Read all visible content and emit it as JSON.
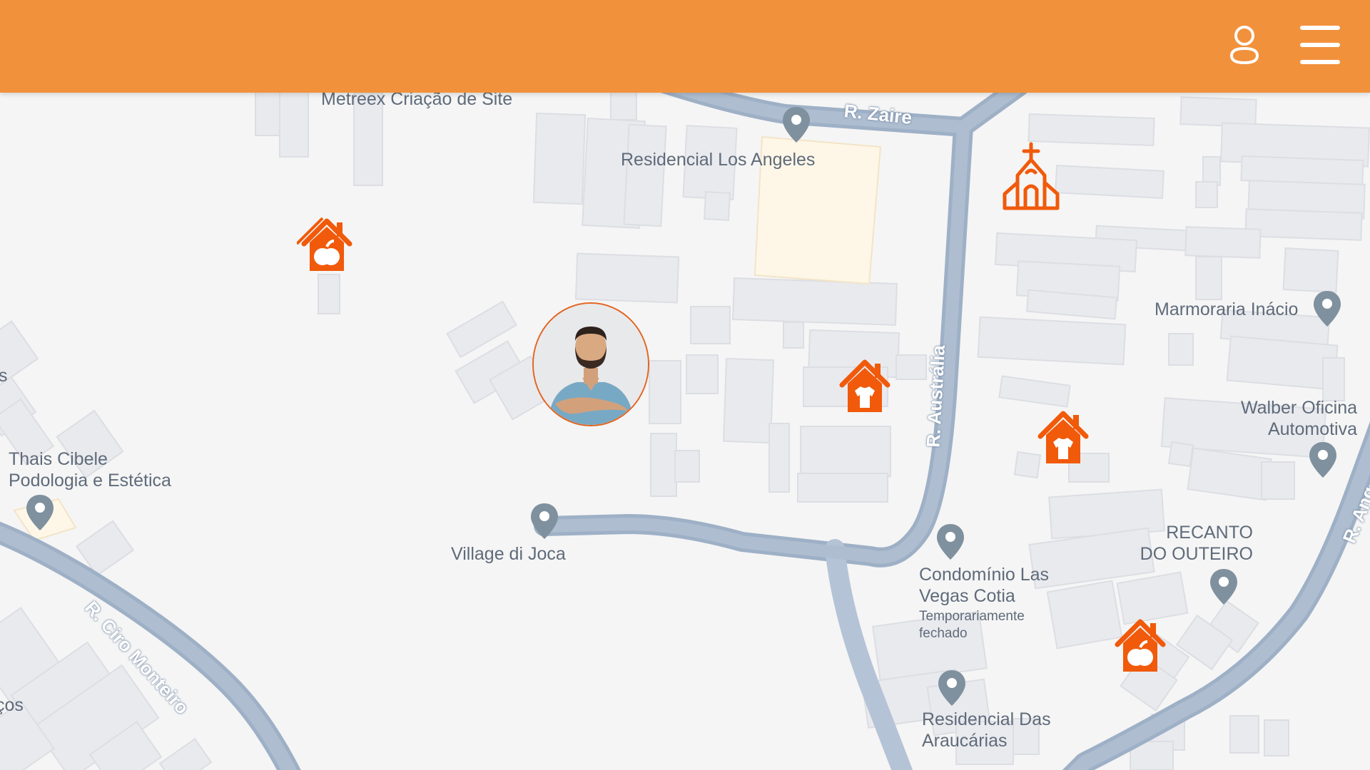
{
  "header": {
    "brand_color": "#f2913c",
    "profile_icon": "user-profile-icon",
    "menu_icon": "hamburger-menu-icon"
  },
  "map": {
    "streets": [
      {
        "name": "R. Zaire"
      },
      {
        "name": "R. Austrália"
      },
      {
        "name": "R. Ciro Monteiro"
      },
      {
        "name": "R. Ang"
      }
    ],
    "places": [
      {
        "name": "Metreex Criação de Site"
      },
      {
        "name": "Residencial Los Angeles"
      },
      {
        "name": "Marmoraria Inácio"
      },
      {
        "name": "Walber Oficina Automotiva"
      },
      {
        "name": "Thais Cibele Podologia e Estética"
      },
      {
        "name": "Village di Joca"
      },
      {
        "name": "Condomínio Las Vegas Cotia",
        "status": "Temporariamente fechado"
      },
      {
        "name": "RECANTO DO OUTEIRO"
      },
      {
        "name": "Residencial Das Araucárias"
      }
    ],
    "edge_labels": [
      "s",
      "ços"
    ]
  },
  "markers": [
    {
      "type": "food-house",
      "icon": "house-apple-icon"
    },
    {
      "type": "clothing-house",
      "icon": "house-shirt-icon"
    },
    {
      "type": "clothing-house",
      "icon": "house-shirt-icon"
    },
    {
      "type": "food-house",
      "icon": "house-apple-icon"
    },
    {
      "type": "church",
      "icon": "church-icon"
    }
  ],
  "marker_color": "#f05a0a",
  "user_avatar": {
    "icon": "user-avatar-photo"
  }
}
